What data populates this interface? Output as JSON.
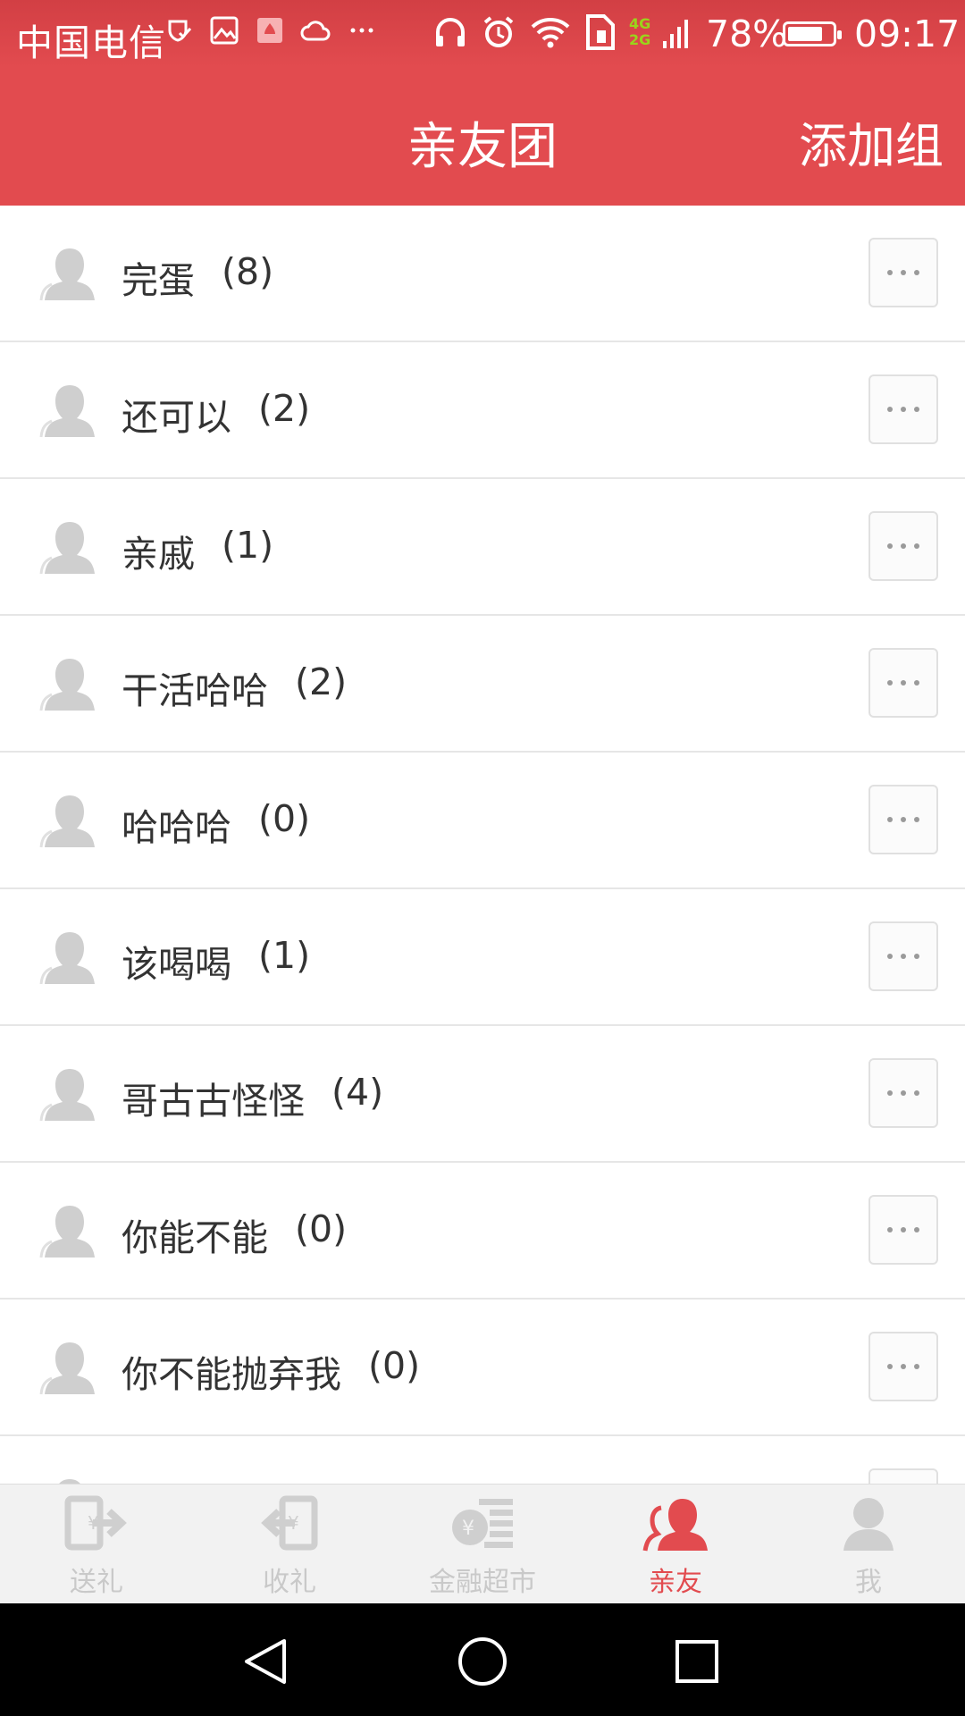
{
  "status_bar": {
    "carrier": "中国电信",
    "network_top": "4G",
    "network_bottom": "2G",
    "battery": "78%",
    "time": "09:17"
  },
  "header": {
    "title": "亲友团",
    "add_group_label": "添加组"
  },
  "groups": [
    {
      "name": "完蛋",
      "count": "(8)"
    },
    {
      "name": "还可以",
      "count": "(2)"
    },
    {
      "name": "亲戚",
      "count": "(1)"
    },
    {
      "name": "干活哈哈",
      "count": "(2)"
    },
    {
      "name": "哈哈哈",
      "count": "(0)"
    },
    {
      "name": "该喝喝",
      "count": "(1)"
    },
    {
      "name": "哥古古怪怪",
      "count": "(4)"
    },
    {
      "name": "你能不能",
      "count": "(0)"
    },
    {
      "name": "你不能抛弃我",
      "count": "(0)"
    }
  ],
  "tabs": [
    {
      "label": "送礼",
      "icon": "send-gift-icon"
    },
    {
      "label": "收礼",
      "icon": "receive-gift-icon"
    },
    {
      "label": "金融超市",
      "icon": "finance-market-icon"
    },
    {
      "label": "亲友",
      "icon": "friends-icon"
    },
    {
      "label": "我",
      "icon": "profile-icon"
    }
  ],
  "active_tab": "亲友",
  "colors": {
    "brand_red": "#e24b4f",
    "tab_inactive": "#c9c9c9",
    "text_primary": "#333333"
  }
}
